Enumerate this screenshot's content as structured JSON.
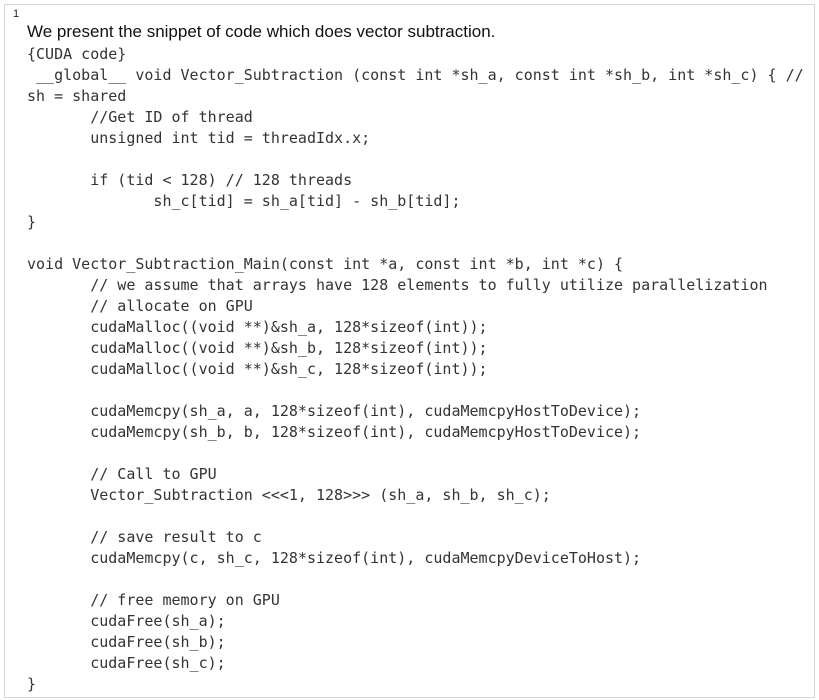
{
  "line_number": "1",
  "intro_text": "We present the snippet of code which does vector subtraction.",
  "code_lines": [
    "{CUDA code}",
    " __global__ void Vector_Subtraction (const int *sh_a, const int *sh_b, int *sh_c) { //",
    "sh = shared",
    "       //Get ID of thread",
    "       unsigned int tid = threadIdx.x;",
    "",
    "       if (tid < 128) // 128 threads",
    "              sh_c[tid] = sh_a[tid] - sh_b[tid];",
    "}",
    "",
    "void Vector_Subtraction_Main(const int *a, const int *b, int *c) {",
    "       // we assume that arrays have 128 elements to fully utilize parallelization",
    "       // allocate on GPU",
    "       cudaMalloc((void **)&sh_a, 128*sizeof(int));",
    "       cudaMalloc((void **)&sh_b, 128*sizeof(int));",
    "       cudaMalloc((void **)&sh_c, 128*sizeof(int));",
    "",
    "       cudaMemcpy(sh_a, a, 128*sizeof(int), cudaMemcpyHostToDevice);",
    "       cudaMemcpy(sh_b, b, 128*sizeof(int), cudaMemcpyHostToDevice);",
    "",
    "       // Call to GPU",
    "       Vector_Subtraction <<<1, 128>>> (sh_a, sh_b, sh_c);",
    "",
    "       // save result to c",
    "       cudaMemcpy(c, sh_c, 128*sizeof(int), cudaMemcpyDeviceToHost);",
    "",
    "       // free memory on GPU",
    "       cudaFree(sh_a);",
    "       cudaFree(sh_b);",
    "       cudaFree(sh_c);",
    "}"
  ]
}
